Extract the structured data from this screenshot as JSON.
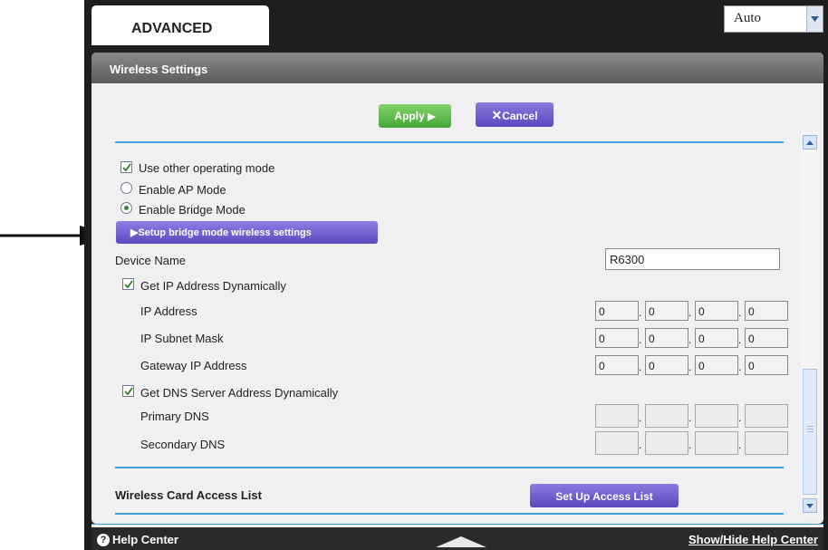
{
  "header": {
    "tab_label": "ADVANCED",
    "language_select": {
      "value": "Auto"
    }
  },
  "panel": {
    "title": "Wireless Settings",
    "apply_label": "Apply",
    "cancel_label": "Cancel"
  },
  "mode": {
    "use_other_label": "Use other operating mode",
    "use_other_checked": true,
    "ap_label": "Enable AP Mode",
    "bridge_label": "Enable Bridge Mode",
    "selected": "bridge",
    "setup_bridge_label": "Setup bridge mode wireless settings"
  },
  "device": {
    "label": "Device Name",
    "value": "R6300"
  },
  "ip": {
    "dynamic_label": "Get IP Address Dynamically",
    "dynamic_checked": true,
    "rows": [
      {
        "label": "IP Address",
        "octets": [
          "0",
          "0",
          "0",
          "0"
        ]
      },
      {
        "label": "IP Subnet Mask",
        "octets": [
          "0",
          "0",
          "0",
          "0"
        ]
      },
      {
        "label": "Gateway IP Address",
        "octets": [
          "0",
          "0",
          "0",
          "0"
        ]
      }
    ]
  },
  "dns": {
    "dynamic_label": "Get DNS Server Address Dynamically",
    "dynamic_checked": true,
    "rows": [
      {
        "label": "Primary DNS",
        "octets": [
          "",
          "",
          "",
          ""
        ]
      },
      {
        "label": "Secondary DNS",
        "octets": [
          "",
          "",
          "",
          ""
        ]
      }
    ]
  },
  "access_list": {
    "title": "Wireless Card Access List",
    "button_label": "Set Up Access List"
  },
  "footer": {
    "help_label": "Help Center",
    "toggle_label": "Show/Hide Help Center"
  },
  "colors": {
    "apply": "#4aa639",
    "accent_purple": "#5c47be",
    "rule_blue": "#3aa3d3"
  },
  "icons": [
    "callout-arrow-icon",
    "dropdown-arrow-icon",
    "play-triangle-icon",
    "x-icon",
    "checkmark-icon",
    "scroll-up-icon",
    "scroll-down-icon",
    "help-icon"
  ]
}
